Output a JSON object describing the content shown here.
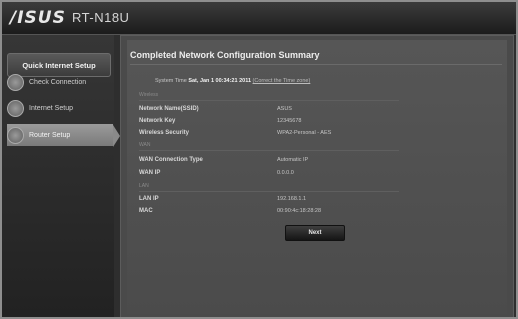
{
  "header": {
    "brand": "/ISUS",
    "model": "RT-N18U"
  },
  "sidebar": {
    "title": "Quick Internet Setup",
    "steps": [
      {
        "label": "Check Connection"
      },
      {
        "label": "Internet Setup"
      },
      {
        "label": "Router Setup"
      }
    ]
  },
  "summary": {
    "title": "Completed Network Configuration Summary",
    "system_time_label": "System Time",
    "system_time_value": "Sat, Jan 1 00:34:21 2011",
    "system_time_link": "(Correct the Time zone)",
    "wireless": {
      "section": "Wireless",
      "ssid_label": "Network Name(SSID)",
      "ssid_value": "ASUS",
      "key_label": "Network Key",
      "key_value": "12345678",
      "security_label": "Wireless Security",
      "security_value": "WPA2-Personal - AES"
    },
    "wan": {
      "section": "WAN",
      "type_label": "WAN Connection Type",
      "type_value": "Automatic IP",
      "ip_label": "WAN IP",
      "ip_value": "0.0.0.0"
    },
    "lan": {
      "section": "LAN",
      "ip_label": "LAN IP",
      "ip_value": "192.168.1.1",
      "mac_label": "MAC",
      "mac_value": "00:90:4c:18:28:28"
    },
    "next_label": "Next"
  }
}
